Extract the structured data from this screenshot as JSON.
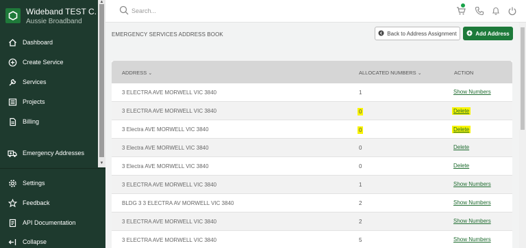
{
  "sidebar": {
    "brand_title": "Wideband TEST C...",
    "brand_subtitle": "Aussie Broadband",
    "items": [
      {
        "label": "Dashboard",
        "icon": "home-icon"
      },
      {
        "label": "Create Service",
        "icon": "plus-circle-icon"
      },
      {
        "label": "Services",
        "icon": "wrench-icon"
      },
      {
        "label": "Projects",
        "icon": "list-icon"
      },
      {
        "label": "Billing",
        "icon": "document-icon"
      },
      {
        "label": "Emergency Addresses",
        "icon": "ambulance-icon"
      },
      {
        "label": "Settings",
        "icon": "gear-icon"
      },
      {
        "label": "Feedback",
        "icon": "star-icon"
      },
      {
        "label": "API Documentation",
        "icon": "api-doc-icon"
      },
      {
        "label": "Collapse",
        "icon": "collapse-icon"
      }
    ]
  },
  "topbar": {
    "search_placeholder": "Search..."
  },
  "header": {
    "title": "EMERGENCY SERVICES ADDRESS BOOK",
    "back_label": "Back to Address Assignment",
    "add_label": "Add Address"
  },
  "table": {
    "columns": [
      "ADDRESS",
      "ALLOCATED NUMBERS",
      "ACTION"
    ],
    "rows": [
      {
        "address": "3 ELECTRA AVE MORWELL VIC 3840",
        "numbers": "1",
        "action": "Show Numbers"
      },
      {
        "address": "3 ELECTRA AVE MORWELL VIC 3840",
        "numbers": "0",
        "action": "Delete"
      },
      {
        "address": "3 Electra AVE MORWELL VIC 3840",
        "numbers": "0",
        "action": "Delete"
      },
      {
        "address": "3 Electra AVE MORWELL VIC 3840",
        "numbers": "0",
        "action": "Delete"
      },
      {
        "address": "3 Electra AVE MORWELL VIC 3840",
        "numbers": "0",
        "action": "Delete"
      },
      {
        "address": "3 ELECTRA AVE MORWELL VIC 3840",
        "numbers": "1",
        "action": "Show Numbers"
      },
      {
        "address": "BLDG 3 3 ELECTRA AV MORWELL VIC 3840",
        "numbers": "2",
        "action": "Show Numbers"
      },
      {
        "address": "3 ELECTRA AVE MORWELL VIC 3840",
        "numbers": "2",
        "action": "Show Numbers"
      },
      {
        "address": "3 ELECTRA AVE MORWELL VIC 3840",
        "numbers": "5",
        "action": "Show Numbers"
      }
    ]
  },
  "colors": {
    "sidebar_bg": "#1e3a2e",
    "accent_green": "#1d7a3a",
    "highlight": "#f8f400"
  }
}
